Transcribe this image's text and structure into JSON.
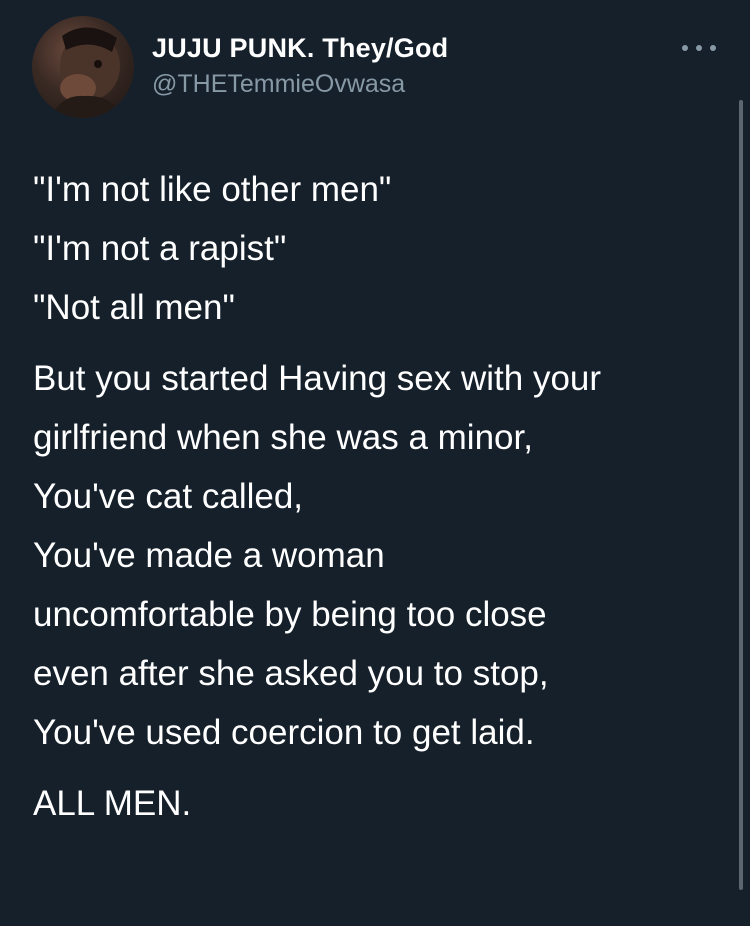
{
  "author": {
    "display_name": "JUJU PUNK. They/God",
    "handle": "@THETemmieOvwasa",
    "avatar_icon": "profile-photo"
  },
  "more_button": {
    "icon": "ellipsis-icon"
  },
  "tweet": {
    "paragraphs": [
      [
        "\"I'm not like other men\"",
        "\"I'm not a rapist\"",
        "\"Not all men\""
      ],
      [
        "But you started Having sex with your",
        "girlfriend when she was a minor,",
        "You've cat called,",
        "You've made a woman",
        "uncomfortable by being too close",
        "even after she asked you to stop,",
        "You've used coercion to get laid."
      ],
      [
        "ALL MEN."
      ]
    ]
  },
  "theme": {
    "background": "#15202b",
    "text": "#ffffff",
    "secondary_text": "#8899a6"
  }
}
